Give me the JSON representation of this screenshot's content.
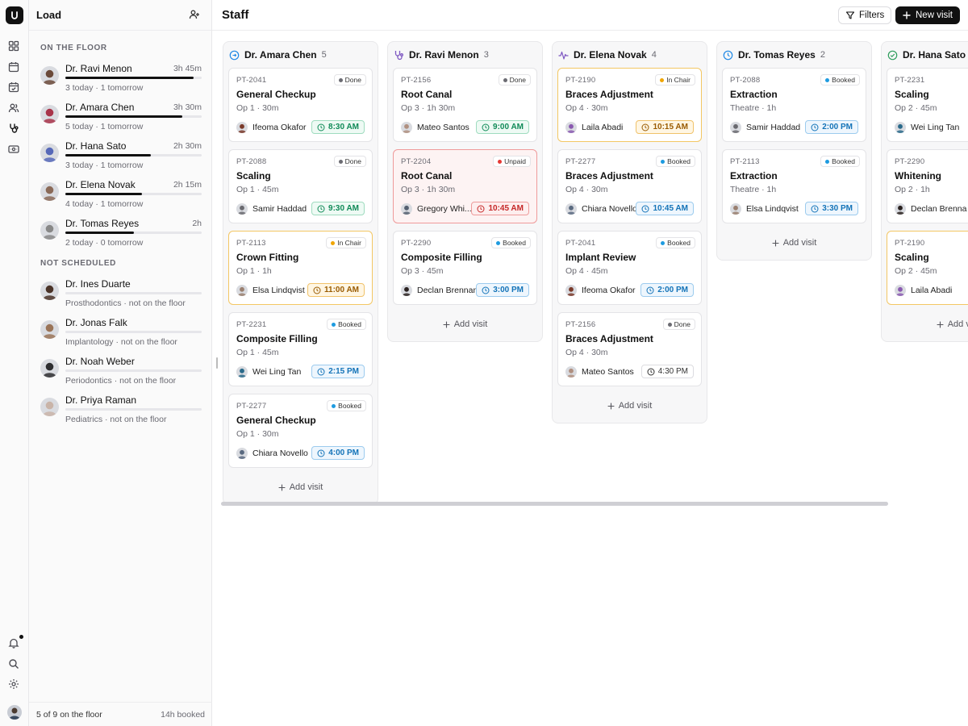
{
  "rail": {
    "icons": [
      "dashboard-icon",
      "calendar-icon",
      "calendar-check-icon",
      "users-icon",
      "stethoscope-icon",
      "id-card-icon",
      "bell-icon",
      "search-icon",
      "gear-icon"
    ]
  },
  "load": {
    "title": "Load",
    "section_on_floor": "On the floor",
    "section_not_scheduled": "Not scheduled",
    "on_floor": [
      {
        "name": "Dr. Ravi Menon",
        "hours": "3h 45m",
        "sub": "3 today · 1 tomorrow",
        "load": 0.94,
        "avatar": "#6b4a3a"
      },
      {
        "name": "Dr. Amara Chen",
        "hours": "3h 30m",
        "sub": "5 today · 1 tomorrow",
        "load": 0.86,
        "avatar": "#a8344a"
      },
      {
        "name": "Dr. Hana Sato",
        "hours": "2h 30m",
        "sub": "3 today · 1 tomorrow",
        "load": 0.63,
        "avatar": "#5668b8"
      },
      {
        "name": "Dr. Elena Novak",
        "hours": "2h 15m",
        "sub": "4 today · 1 tomorrow",
        "load": 0.56,
        "avatar": "#8a6a58"
      },
      {
        "name": "Dr. Tomas Reyes",
        "hours": "2h",
        "sub": "2 today · 0 tomorrow",
        "load": 0.5,
        "avatar": "#888888"
      }
    ],
    "not_scheduled": [
      {
        "name": "Dr. Ines Duarte",
        "sub": "Prosthodontics · not on the floor",
        "avatar": "#4a3328"
      },
      {
        "name": "Dr. Jonas Falk",
        "sub": "Implantology · not on the floor",
        "avatar": "#9a7458"
      },
      {
        "name": "Dr. Noah Weber",
        "sub": "Periodontics · not on the floor",
        "avatar": "#2e2e30"
      },
      {
        "name": "Dr. Priya Raman",
        "sub": "Pediatrics · not on the floor",
        "avatar": "#c9b4a8"
      }
    ],
    "footer_left": "5 of 9 on the floor",
    "footer_right": "14h booked"
  },
  "header": {
    "title": "Staff",
    "filters_label": "Filters",
    "new_visit_label": "New visit"
  },
  "add_visit_label": "Add visit",
  "colors": {
    "done": "#6b6b72",
    "booked": "#1e9be0",
    "in_chair": "#f0a500",
    "unpaid": "#e53935"
  },
  "columns": [
    {
      "doctor": "Dr. Amara Chen",
      "count": "5",
      "icon": "circle-arrow-icon",
      "icon_color": "#1e88e5",
      "cards": [
        {
          "id": "PT-2041",
          "status": "Done",
          "status_key": "done",
          "procedure": "General Checkup",
          "op": "Op 1 · 30m",
          "patient": "Ifeoma Okafor",
          "time": "8:30 AM",
          "time_style": "green",
          "avatar": "#7a3a2a"
        },
        {
          "id": "PT-2088",
          "status": "Done",
          "status_key": "done",
          "procedure": "Scaling",
          "op": "Op 1 · 45m",
          "patient": "Samir Haddad",
          "time": "9:30 AM",
          "time_style": "green",
          "avatar": "#6a6a70"
        },
        {
          "id": "PT-2113",
          "status": "In Chair",
          "status_key": "in_chair",
          "procedure": "Crown Fitting",
          "op": "Op 1 · 1h",
          "patient": "Elsa Lindqvist",
          "time": "11:00 AM",
          "time_style": "amber",
          "avatar": "#9a8070"
        },
        {
          "id": "PT-2231",
          "status": "Booked",
          "status_key": "booked",
          "procedure": "Composite Filling",
          "op": "Op 1 · 45m",
          "patient": "Wei Ling Tan",
          "time": "2:15 PM",
          "time_style": "blue",
          "avatar": "#2a6a8a"
        },
        {
          "id": "PT-2277",
          "status": "Booked",
          "status_key": "booked",
          "procedure": "General Checkup",
          "op": "Op 1 · 30m",
          "patient": "Chiara Novello",
          "time": "4:00 PM",
          "time_style": "blue",
          "avatar": "#5a6a80"
        }
      ]
    },
    {
      "doctor": "Dr. Ravi Menon",
      "count": "3",
      "icon": "stethoscope-icon",
      "icon_color": "#7e57c2",
      "cards": [
        {
          "id": "PT-2156",
          "status": "Done",
          "status_key": "done",
          "procedure": "Root Canal",
          "op": "Op 3 · 1h 30m",
          "patient": "Mateo Santos",
          "time": "9:00 AM",
          "time_style": "green",
          "avatar": "#b09080"
        },
        {
          "id": "PT-2204",
          "status": "Unpaid",
          "status_key": "unpaid",
          "procedure": "Root Canal",
          "op": "Op 3 · 1h 30m",
          "patient": "Gregory Whi...",
          "time": "10:45 AM",
          "time_style": "red",
          "avatar": "#556070",
          "unpaid": true
        },
        {
          "id": "PT-2290",
          "status": "Booked",
          "status_key": "booked",
          "procedure": "Composite Filling",
          "op": "Op 3 · 45m",
          "patient": "Declan Brennan",
          "time": "3:00 PM",
          "time_style": "blue",
          "avatar": "#2a2220"
        }
      ]
    },
    {
      "doctor": "Dr. Elena Novak",
      "count": "4",
      "icon": "activity-icon",
      "icon_color": "#7e57c2",
      "cards": [
        {
          "id": "PT-2190",
          "status": "In Chair",
          "status_key": "in_chair",
          "procedure": "Braces Adjustment",
          "op": "Op 4 · 30m",
          "patient": "Laila Abadi",
          "time": "10:15 AM",
          "time_style": "amber",
          "avatar": "#8a5ab0"
        },
        {
          "id": "PT-2277",
          "status": "Booked",
          "status_key": "booked",
          "procedure": "Braces Adjustment",
          "op": "Op 4 · 30m",
          "patient": "Chiara Novello",
          "time": "10:45 AM",
          "time_style": "blue",
          "avatar": "#5a6a80"
        },
        {
          "id": "PT-2041",
          "status": "Booked",
          "status_key": "booked",
          "procedure": "Implant Review",
          "op": "Op 4 · 45m",
          "patient": "Ifeoma Okafor",
          "time": "2:00 PM",
          "time_style": "blue",
          "avatar": "#7a3a2a"
        },
        {
          "id": "PT-2156",
          "status": "Done",
          "status_key": "done",
          "procedure": "Braces Adjustment",
          "op": "Op 4 · 30m",
          "patient": "Mateo Santos",
          "time": "4:30 PM",
          "time_style": "gray",
          "avatar": "#b09080"
        }
      ]
    },
    {
      "doctor": "Dr. Tomas Reyes",
      "count": "2",
      "icon": "clock-icon",
      "icon_color": "#1e88e5",
      "cards": [
        {
          "id": "PT-2088",
          "status": "Booked",
          "status_key": "booked",
          "procedure": "Extraction",
          "op": "Theatre · 1h",
          "patient": "Samir Haddad",
          "time": "2:00 PM",
          "time_style": "blue",
          "avatar": "#6a6a70"
        },
        {
          "id": "PT-2113",
          "status": "Booked",
          "status_key": "booked",
          "procedure": "Extraction",
          "op": "Theatre · 1h",
          "patient": "Elsa Lindqvist",
          "time": "3:30 PM",
          "time_style": "blue",
          "avatar": "#9a8070"
        }
      ]
    },
    {
      "doctor": "Dr. Hana Sato",
      "count": "",
      "icon": "check-circle-icon",
      "icon_color": "#2e9d5c",
      "cards": [
        {
          "id": "PT-2231",
          "status": "",
          "status_key": "",
          "procedure": "Scaling",
          "op": "Op 2 · 45m",
          "patient": "Wei Ling Tan",
          "time": "",
          "time_style": "",
          "avatar": "#2a6a8a"
        },
        {
          "id": "PT-2290",
          "status": "",
          "status_key": "",
          "procedure": "Whitening",
          "op": "Op 2 · 1h",
          "patient": "Declan Brenna",
          "time": "",
          "time_style": "",
          "avatar": "#2a2220"
        },
        {
          "id": "PT-2190",
          "status": "",
          "status_key": "in_chair",
          "procedure": "Scaling",
          "op": "Op 2 · 45m",
          "patient": "Laila Abadi",
          "time": "",
          "time_style": "",
          "avatar": "#8a5ab0"
        }
      ]
    }
  ]
}
